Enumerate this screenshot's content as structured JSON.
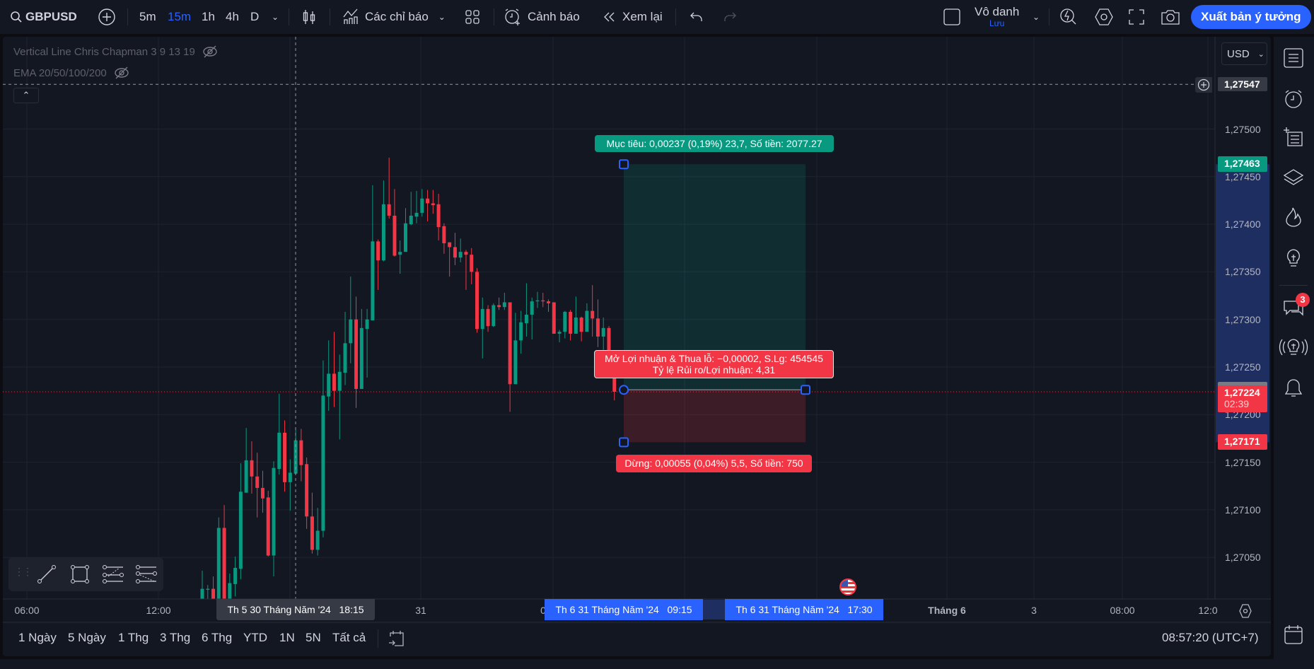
{
  "toolbar": {
    "symbol": "GBPUSD",
    "intervals": [
      "5m",
      "15m",
      "1h",
      "4h",
      "D"
    ],
    "active_interval": "15m",
    "indicators_label": "Các chỉ báo",
    "alert_label": "Cảnh báo",
    "replay_label": "Xem lại",
    "layout_name": "Vô danh",
    "save_label": "Lưu",
    "publish_label": "Xuất bản ý tưởng"
  },
  "legend": {
    "line1": "Vertical Line Chris Chapman 3 9 13 19",
    "line2": "EMA 20/50/100/200"
  },
  "price_axis": {
    "currency": "USD",
    "labels": [
      "1,27500",
      "1,27450",
      "1,27400",
      "1,27350",
      "1,27300",
      "1,27250",
      "1,27200",
      "1,27150",
      "1,27100",
      "1,27050"
    ],
    "crosshair_price": "1,27547",
    "target_price": "1,27463",
    "entry_price": "1,27226",
    "current_price": "1,27224",
    "countdown": "02:39",
    "stop_price": "1,27171"
  },
  "time_axis": {
    "labels": [
      "06:00",
      "12:00",
      "31",
      "0",
      "Tháng 6",
      "3",
      "08:00",
      "12:0"
    ],
    "crosshair_time": "Th 5 30 Tháng Năm '24   18:15",
    "range_start": "Th 6 31 Tháng Năm '24   09:15",
    "range_end": "Th 6 31 Tháng Năm '24   17:30"
  },
  "position_tool": {
    "target_label": "Mục tiêu: 0,00237 (0,19%) 23,7, Số tiền: 2077.27",
    "pnl_label_line1": "Mở Lợi nhuận & Thua lỗ: −0,00002, S.Lg: 454545",
    "pnl_label_line2": "Tỷ lệ Rủi ro/Lợi nhuận: 4,31",
    "stop_label": "Dừng: 0,00055 (0,04%) 5,5, Số tiền: 750"
  },
  "bottom_bar": {
    "ranges": [
      "1 Ngày",
      "5 Ngày",
      "1 Thg",
      "3 Thg",
      "6 Thg",
      "YTD",
      "1N",
      "5N",
      "Tất cả"
    ],
    "clock": "08:57:20 (UTC+7)"
  },
  "right_sidebar": {
    "chat_badge": "3"
  },
  "colors": {
    "up": "#089981",
    "down": "#f23645",
    "accent": "#2962ff",
    "background": "#131722"
  },
  "chart": {
    "type": "candlestick",
    "interval": "15m",
    "price_range": [
      1.27006,
      1.2764
    ],
    "crosshair_price": 1.27547,
    "position": {
      "target": 1.27463,
      "entry": 1.27226,
      "stop": 1.27171
    },
    "current_price": 1.27224,
    "candles_ohlc": [
      [
        1.26995,
        1.27036,
        1.2699,
        1.27017
      ],
      [
        1.27016,
        1.27021,
        1.27006,
        1.27017
      ],
      [
        1.27017,
        1.2703,
        1.2699,
        1.26995
      ],
      [
        1.2699,
        1.27092,
        1.26985,
        1.27081
      ],
      [
        1.27081,
        1.27105,
        1.26985,
        1.2699
      ],
      [
        1.27,
        1.27033,
        1.26995,
        1.27023
      ],
      [
        1.27022,
        1.27051,
        1.27009,
        1.27039
      ],
      [
        1.27038,
        1.27149,
        1.27027,
        1.27119
      ],
      [
        1.27118,
        1.27186,
        1.27118,
        1.27152
      ],
      [
        1.27152,
        1.27172,
        1.27117,
        1.27135
      ],
      [
        1.27135,
        1.2716,
        1.27092,
        1.27123
      ],
      [
        1.27123,
        1.27141,
        1.27097,
        1.27112
      ],
      [
        1.27113,
        1.2712,
        1.27051,
        1.27052
      ],
      [
        1.27052,
        1.27151,
        1.2703,
        1.27144
      ],
      [
        1.27143,
        1.27222,
        1.27137,
        1.27181
      ],
      [
        1.27181,
        1.27194,
        1.27119,
        1.27129
      ],
      [
        1.27129,
        1.27153,
        1.27099,
        1.27139
      ],
      [
        1.27138,
        1.27184,
        1.27138,
        1.27173
      ],
      [
        1.27173,
        1.27185,
        1.2713,
        1.27147
      ],
      [
        1.27148,
        1.27155,
        1.2708,
        1.27093
      ],
      [
        1.27093,
        1.27118,
        1.27054,
        1.27058
      ],
      [
        1.27058,
        1.27102,
        1.27052,
        1.27078
      ],
      [
        1.27078,
        1.27257,
        1.27071,
        1.2722
      ],
      [
        1.27219,
        1.27278,
        1.27204,
        1.27243
      ],
      [
        1.27243,
        1.27287,
        1.27208,
        1.27225
      ],
      [
        1.27225,
        1.27263,
        1.27174,
        1.27245
      ],
      [
        1.27244,
        1.27308,
        1.27231,
        1.27275
      ],
      [
        1.27275,
        1.27345,
        1.27254,
        1.273
      ],
      [
        1.273,
        1.27324,
        1.27207,
        1.27227
      ],
      [
        1.27227,
        1.27311,
        1.27227,
        1.27291
      ],
      [
        1.2729,
        1.27311,
        1.27239,
        1.273
      ],
      [
        1.27299,
        1.27441,
        1.27299,
        1.27382
      ],
      [
        1.27382,
        1.27384,
        1.27331,
        1.27362
      ],
      [
        1.27362,
        1.27446,
        1.27361,
        1.27421
      ],
      [
        1.27421,
        1.2747,
        1.27406,
        1.27409
      ],
      [
        1.27409,
        1.27437,
        1.27366,
        1.27367
      ],
      [
        1.27368,
        1.27383,
        1.27348,
        1.27371
      ],
      [
        1.27371,
        1.27417,
        1.27371,
        1.27401
      ],
      [
        1.274,
        1.27434,
        1.27399,
        1.27409
      ],
      [
        1.27408,
        1.27435,
        1.27401,
        1.27412
      ],
      [
        1.27412,
        1.27437,
        1.27408,
        1.27427
      ],
      [
        1.27427,
        1.27436,
        1.27403,
        1.27422
      ],
      [
        1.27422,
        1.27436,
        1.27411,
        1.2742
      ],
      [
        1.27421,
        1.27432,
        1.27383,
        1.27397
      ],
      [
        1.27398,
        1.27401,
        1.27369,
        1.2738
      ],
      [
        1.27381,
        1.27381,
        1.27345,
        1.27376
      ],
      [
        1.27376,
        1.27391,
        1.27357,
        1.27365
      ],
      [
        1.27365,
        1.27385,
        1.2736,
        1.27371
      ],
      [
        1.27371,
        1.27373,
        1.27331,
        1.27368
      ],
      [
        1.27368,
        1.27375,
        1.27337,
        1.2735
      ],
      [
        1.2735,
        1.27354,
        1.27286,
        1.2729
      ],
      [
        1.2729,
        1.27323,
        1.27259,
        1.27311
      ],
      [
        1.27311,
        1.27315,
        1.27287,
        1.27293
      ],
      [
        1.27293,
        1.27317,
        1.27292,
        1.27315
      ],
      [
        1.27315,
        1.27323,
        1.2731,
        1.27313
      ],
      [
        1.27313,
        1.27328,
        1.2731,
        1.27318
      ],
      [
        1.27318,
        1.27318,
        1.27203,
        1.27232
      ],
      [
        1.27232,
        1.27307,
        1.27232,
        1.27278
      ],
      [
        1.27278,
        1.27309,
        1.27264,
        1.27297
      ],
      [
        1.27296,
        1.27338,
        1.27282,
        1.27305
      ],
      [
        1.27305,
        1.27323,
        1.27279,
        1.27319
      ],
      [
        1.27319,
        1.27329,
        1.27312,
        1.2732
      ],
      [
        1.2732,
        1.27328,
        1.27313,
        1.27319
      ],
      [
        1.27319,
        1.27321,
        1.27308,
        1.27317
      ],
      [
        1.27318,
        1.27318,
        1.27285,
        1.27285
      ],
      [
        1.27285,
        1.27289,
        1.27276,
        1.27287
      ],
      [
        1.27287,
        1.27309,
        1.2728,
        1.27308
      ],
      [
        1.27308,
        1.2731,
        1.27278,
        1.27285
      ],
      [
        1.27285,
        1.27324,
        1.27285,
        1.27302
      ],
      [
        1.27302,
        1.27303,
        1.27277,
        1.27287
      ],
      [
        1.27287,
        1.27317,
        1.27287,
        1.27309
      ],
      [
        1.27309,
        1.27336,
        1.27282,
        1.27301
      ],
      [
        1.27301,
        1.27321,
        1.27271,
        1.27282
      ],
      [
        1.27282,
        1.27302,
        1.27268,
        1.27291
      ],
      [
        1.27291,
        1.27293,
        1.27262,
        1.27264
      ],
      [
        1.27262,
        1.27264,
        1.27215,
        1.27224
      ]
    ]
  }
}
